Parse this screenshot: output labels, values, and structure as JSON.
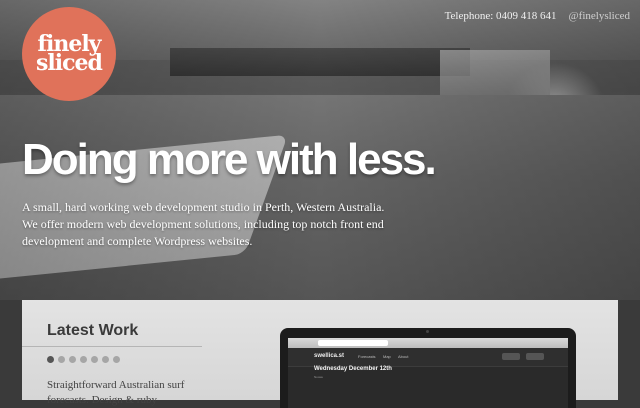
{
  "header": {
    "logo_line1": "finely",
    "logo_line2": "sliced",
    "telephone": "Telephone: 0409 418 641",
    "twitter": "@finelysliced"
  },
  "hero": {
    "headline": "Doing more with less.",
    "intro": "A small, hard working web development studio in Perth, Western Australia. We offer modern web development solutions, including top notch front end development and complete Wordpress websites."
  },
  "latest_work": {
    "title": "Latest Work",
    "slider_dots": 7,
    "active_dot": 0,
    "description": "Straightforward Australian surf forecasts. Design & ruby"
  },
  "mockup": {
    "site_logo": "swellica.st",
    "nav": [
      "Forecasts",
      "Map",
      "About"
    ],
    "date": "Wednesday December 12th",
    "sub": "Noosa"
  },
  "colors": {
    "logo": "#e0725a",
    "panel": "#dddddd"
  }
}
